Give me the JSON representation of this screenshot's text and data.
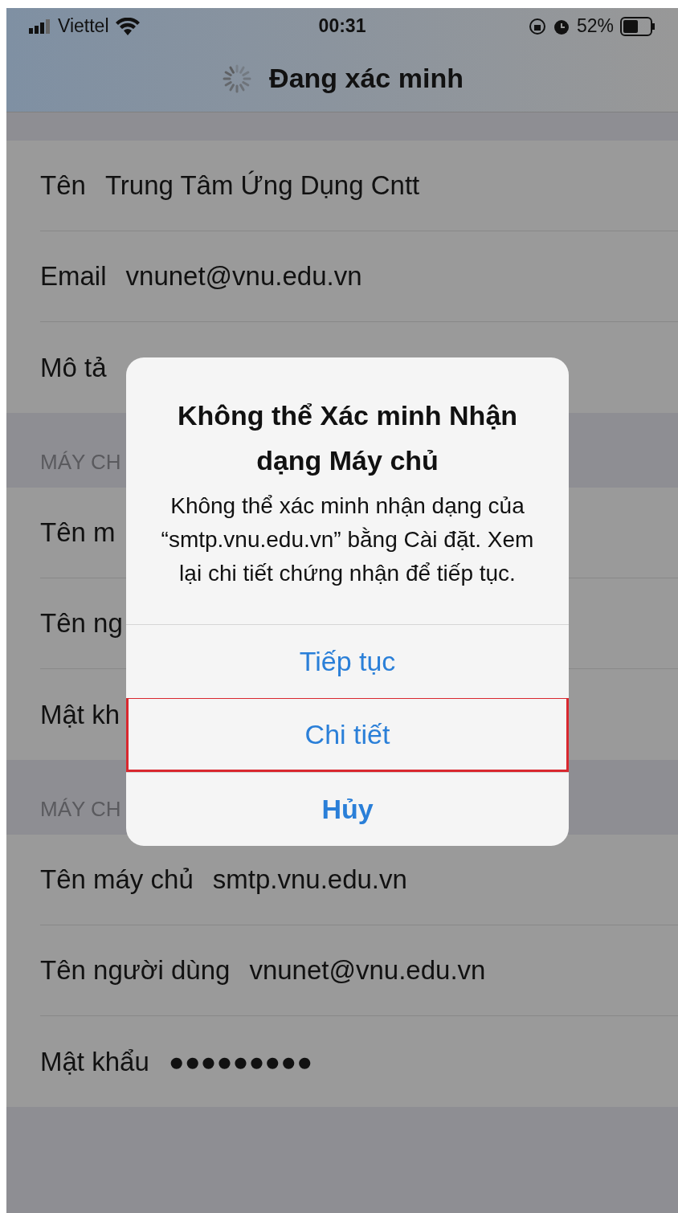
{
  "status_bar": {
    "carrier": "Viettel",
    "time": "00:31",
    "battery": "52%"
  },
  "nav": {
    "title": "Đang xác minh"
  },
  "sections": [
    {
      "rows": [
        {
          "label": "Tên",
          "value": "Trung Tâm Ứng Dụng Cntt"
        },
        {
          "label": "Email",
          "value": "vnunet@vnu.edu.vn"
        },
        {
          "label": "Mô tả"
        }
      ]
    },
    {
      "header": "MÁY CH",
      "rows": [
        {
          "label": "Tên m"
        },
        {
          "label": "Tên ng"
        },
        {
          "label": "Mật kh"
        }
      ]
    },
    {
      "header": "MÁY CH",
      "rows": [
        {
          "label": "Tên máy chủ",
          "value": "smtp.vnu.edu.vn"
        },
        {
          "label": "Tên người dùng",
          "value": "vnunet@vnu.edu.vn"
        },
        {
          "label": "Mật khẩu",
          "value": "●●●●●●●●●"
        }
      ]
    }
  ],
  "alert": {
    "title": "Không thể Xác minh Nhận dạng Máy chủ",
    "message": "Không thể xác minh nhận dạng của “smtp.vnu.edu.vn” bằng Cài đặt. Xem lại chi tiết chứng nhận để tiếp tục.",
    "actions": [
      {
        "label": "Tiếp tục",
        "kind": "default",
        "highlighted": false
      },
      {
        "label": "Chi tiết",
        "kind": "default",
        "highlighted": true
      },
      {
        "label": "Hủy",
        "kind": "cancel",
        "highlighted": false
      }
    ]
  }
}
